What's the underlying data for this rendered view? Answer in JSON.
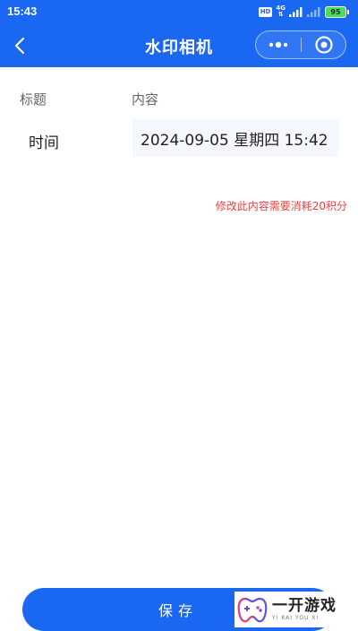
{
  "status_bar": {
    "time": "15:43",
    "hd_badge": "HD",
    "network": "4G",
    "battery": "95"
  },
  "nav": {
    "title": "水印相机"
  },
  "columns": {
    "title_header": "标题",
    "content_header": "内容"
  },
  "fields": [
    {
      "label": "时间",
      "value": "2024-09-05 星期四 15:42"
    }
  ],
  "notice": "修改此内容需要消耗20积分",
  "save_label": "保存",
  "watermark": {
    "name": "一开游戏",
    "pinyin": "YI KAI YOU XI"
  },
  "colors": {
    "primary": "#1a67f2",
    "notice": "#e64340",
    "input_bg": "#f4f8fd"
  }
}
